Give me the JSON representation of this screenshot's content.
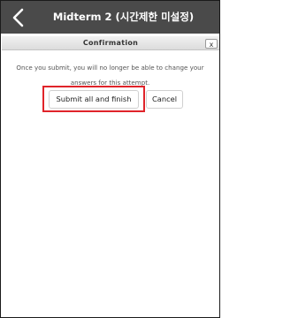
{
  "header": {
    "title": "Midterm 2 (시간제한 미설정)",
    "back_icon": "chevron-left-icon"
  },
  "dialog": {
    "title": "Confirmation",
    "close_label": "x",
    "message_line1": "Once you submit, you will no longer be able to change your",
    "message_line2": "answers for this attempt.",
    "submit_label": "Submit all and finish",
    "cancel_label": "Cancel",
    "highlight_color": "#e0242a"
  }
}
